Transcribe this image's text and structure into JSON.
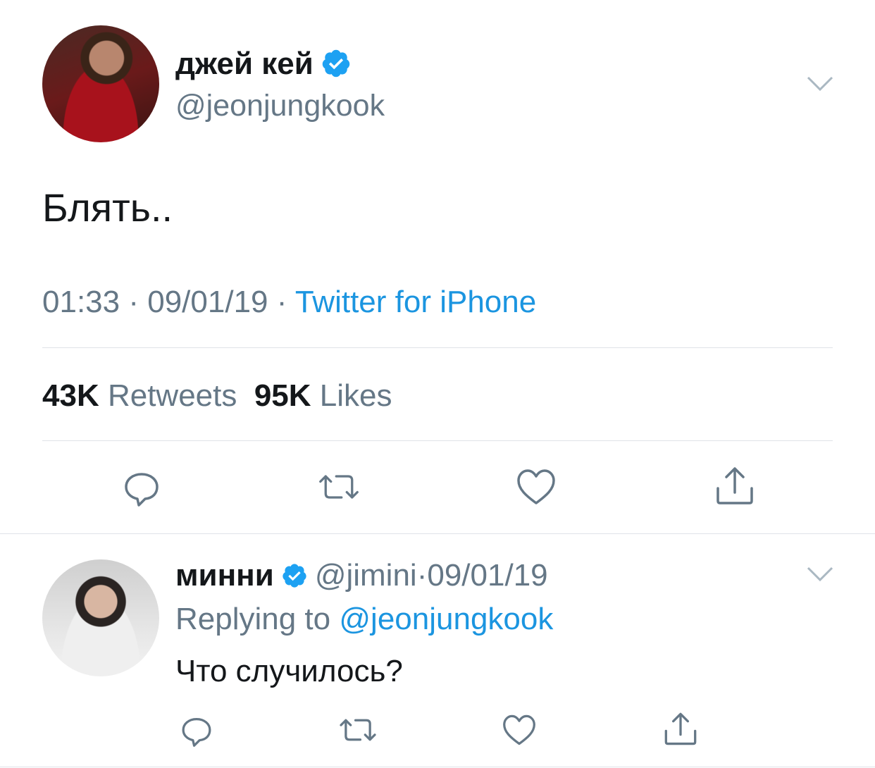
{
  "tweet": {
    "author_name": "джей кей",
    "author_handle": "@jeonjungkook",
    "text": "Блять..",
    "time": "01:33",
    "date": "09/01/19",
    "separator": "·",
    "source": "Twitter for iPhone",
    "retweets_count": "43K",
    "retweets_label": "Retweets",
    "likes_count": "95K",
    "likes_label": "Likes"
  },
  "reply": {
    "author_name": "минни",
    "author_handle": "@jimini",
    "separator": "·",
    "date": "09/01/19",
    "replying_label": "Replying to",
    "replying_handle": "@jeonjungkook",
    "text": "Что случилось?"
  },
  "icons": {
    "verified": "verified-badge-icon",
    "chevron": "chevron-down-icon",
    "reply": "reply-icon",
    "retweet": "retweet-icon",
    "like": "heart-icon",
    "share": "share-icon"
  },
  "colors": {
    "accent": "#1b95e0",
    "secondary_text": "#657786",
    "primary_text": "#14171a",
    "verified": "#1da1f2",
    "divider": "#dfe3e8"
  }
}
